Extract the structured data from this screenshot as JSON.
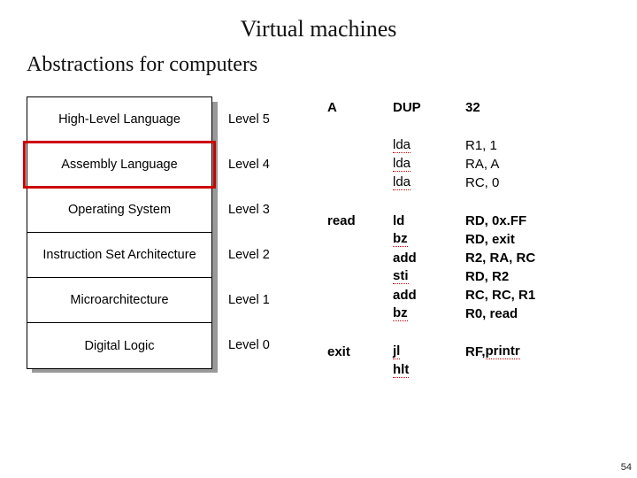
{
  "title": "Virtual machines",
  "subtitle": "Abstractions for computers",
  "layers": [
    {
      "name": "High-Level Language",
      "level": "Level 5"
    },
    {
      "name": "Assembly Language",
      "level": "Level 4"
    },
    {
      "name": "Operating System",
      "level": "Level 3"
    },
    {
      "name": "Instruction Set Architecture",
      "level": "Level 2"
    },
    {
      "name": "Microarchitecture",
      "level": "Level 1"
    },
    {
      "name": "Digital Logic",
      "level": "Level 0"
    }
  ],
  "highlight_index": 1,
  "asm": {
    "col_a": [
      "A",
      "",
      "",
      "",
      "",
      "read",
      "",
      "",
      "",
      "",
      "",
      "",
      "exit"
    ],
    "col_b": [
      {
        "t": "DUP",
        "dotted": false
      },
      {
        "t": "",
        "dotted": false
      },
      {
        "t": "lda",
        "dotted": true
      },
      {
        "t": "lda",
        "dotted": true
      },
      {
        "t": "lda",
        "dotted": true
      },
      {
        "t": "",
        "dotted": false
      },
      {
        "t": "ld",
        "dotted": false
      },
      {
        "t": "bz",
        "dotted": true
      },
      {
        "t": "add",
        "dotted": false
      },
      {
        "t": "sti",
        "dotted": true
      },
      {
        "t": "add",
        "dotted": false
      },
      {
        "t": "bz",
        "dotted": true
      },
      {
        "t": "",
        "dotted": false
      },
      {
        "t": "jl",
        "dotted": true
      },
      {
        "t": "hlt",
        "dotted": true
      }
    ],
    "col_c": [
      "32",
      "",
      "R1, 1",
      "RA, A",
      "RC, 0",
      "",
      "RD, 0x.FF",
      "RD, exit",
      "R2, RA, RC",
      "RD, R2",
      "RC, RC, R1",
      "R0, read",
      "",
      "RF, printr",
      ""
    ],
    "printr_dotted": true
  },
  "page_number": "54"
}
